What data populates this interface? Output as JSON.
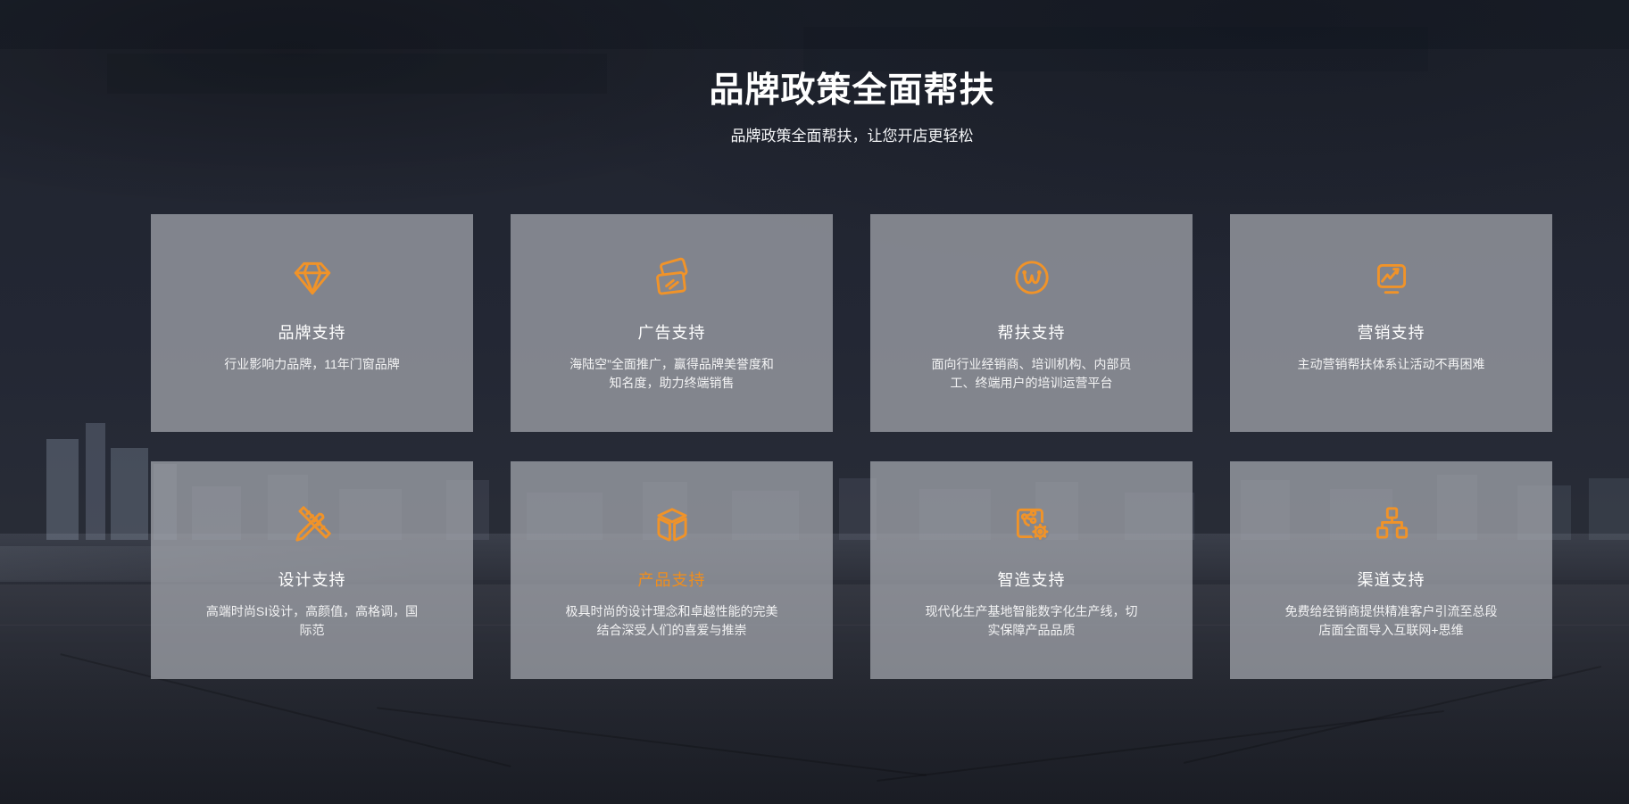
{
  "header": {
    "title": "品牌政策全面帮扶",
    "subtitle": "品牌政策全面帮扶，让您开店更轻松"
  },
  "colors": {
    "accent_orange": "#F09329",
    "active_title_orange": "#EF8E1E",
    "background_dark": "#232733",
    "card_gray": "#83858C",
    "title_white": "#FFFFFF"
  },
  "cards": [
    {
      "icon": "brand-diamond-icon",
      "title": "品牌支持",
      "desc": "行业影响力品牌，11年门窗品牌",
      "active": false
    },
    {
      "icon": "ad-cards-icon",
      "title": "广告支持",
      "desc": "海陆空”全面推广，赢得品牌美誉度和知名度，助力终端销售",
      "active": false
    },
    {
      "icon": "support-wave-icon",
      "title": "帮扶支持",
      "desc": "面向行业经销商、培训机构、内部员工、终端用户的培训运营平台",
      "active": false
    },
    {
      "icon": "marketing-monitor-icon",
      "title": "营销支持",
      "desc": "主动营销帮扶体系让活动不再困难",
      "active": false
    },
    {
      "icon": "design-tools-icon",
      "title": "设计支持",
      "desc": "高端时尚SI设计，高颜值，高格调，国际范",
      "active": false
    },
    {
      "icon": "product-cube-icon",
      "title": "产品支持",
      "desc": "极具时尚的设计理念和卓越性能的完美结合深受人们的喜爱与推崇",
      "active": true
    },
    {
      "icon": "smart-manufacture-icon",
      "title": "智造支持",
      "desc": "现代化生产基地智能数字化生产线，切实保障产品品质",
      "active": false
    },
    {
      "icon": "channel-network-icon",
      "title": "渠道支持",
      "desc": "免费给经销商提供精准客户引流至总段店面全面导入互联网+思维",
      "active": false
    }
  ]
}
